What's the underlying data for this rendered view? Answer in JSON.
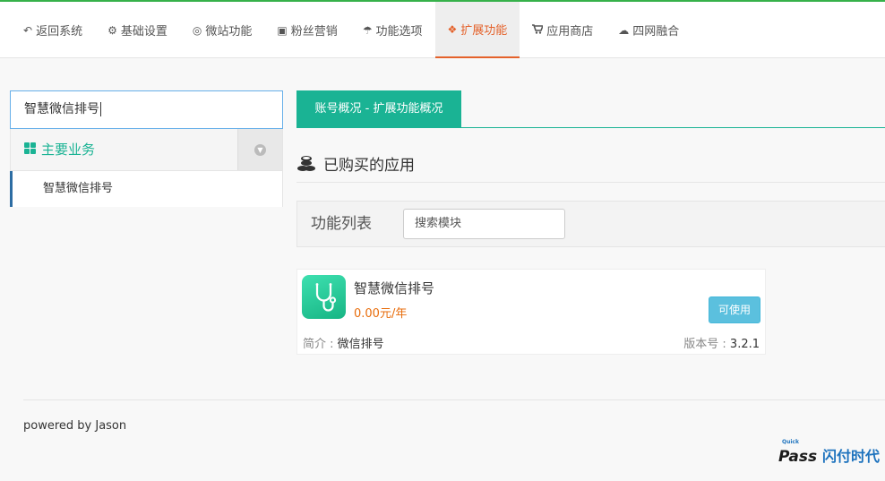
{
  "nav": {
    "items": [
      {
        "label": "返回系统",
        "icon": "reply-icon",
        "glyph": "↶"
      },
      {
        "label": "基础设置",
        "icon": "gear-icon",
        "glyph": "⚙"
      },
      {
        "label": "微站功能",
        "icon": "lifebuoy-icon",
        "glyph": "◎"
      },
      {
        "label": "粉丝营销",
        "icon": "gift-icon",
        "glyph": "▣"
      },
      {
        "label": "功能选项",
        "icon": "umbrella-icon",
        "glyph": "☂"
      },
      {
        "label": "扩展功能",
        "icon": "coins-icon",
        "glyph": "❖"
      },
      {
        "label": "应用商店",
        "icon": "cart-icon",
        "glyph": "▾"
      },
      {
        "label": "四网融合",
        "icon": "cloud-upload-icon",
        "glyph": "☁"
      }
    ],
    "active_index": 5,
    "accent": "#e4612a"
  },
  "sidebar": {
    "search_value": "智慧微信排号",
    "group_title": "主要业务",
    "items": [
      {
        "label": "智慧微信排号"
      }
    ]
  },
  "main": {
    "tab_label": "账号概况 - 扩展功能概况",
    "section_title": "已购买的应用",
    "filter_label": "功能列表",
    "filter_placeholder": "搜索模块",
    "app": {
      "name": "智慧微信排号",
      "price": "0.00元/年",
      "button": "可使用",
      "intro_label": "简介 : ",
      "intro_value": "微信排号",
      "version_label": "版本号 : ",
      "version_value": "3.2.1"
    }
  },
  "footer": {
    "text": "powered by Jason"
  },
  "brand": {
    "quick": "Quick",
    "pass": "Pass",
    "cn": "闪付时代"
  },
  "colors": {
    "teal": "#1ab394",
    "green_top": "#36b14a",
    "info_btn": "#5bc0de",
    "price": "#e86d0c"
  }
}
